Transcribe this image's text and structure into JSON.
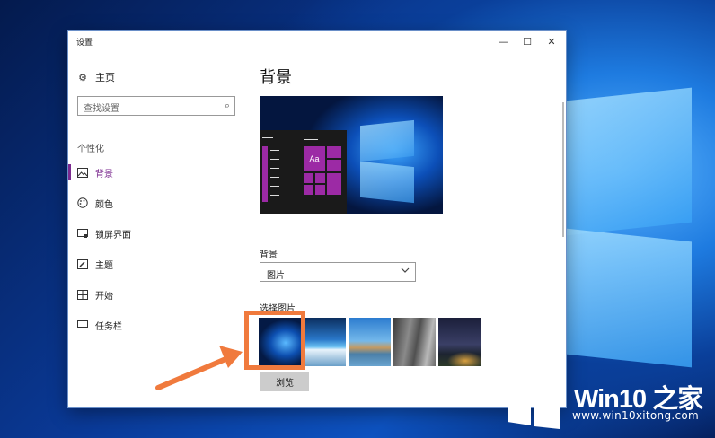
{
  "window": {
    "title": "设置",
    "controls": {
      "minimize": "—",
      "maximize": "☐",
      "close": "✕"
    }
  },
  "sidebar": {
    "home_label": "主页",
    "search_placeholder": "查找设置",
    "section_label": "个性化",
    "items": [
      {
        "label": "背景",
        "icon": "picture-icon",
        "active": true
      },
      {
        "label": "颜色",
        "icon": "palette-icon",
        "active": false
      },
      {
        "label": "锁屏界面",
        "icon": "lock-screen-icon",
        "active": false
      },
      {
        "label": "主题",
        "icon": "theme-icon",
        "active": false
      },
      {
        "label": "开始",
        "icon": "start-icon",
        "active": false
      },
      {
        "label": "任务栏",
        "icon": "taskbar-icon",
        "active": false
      }
    ]
  },
  "main": {
    "page_title": "背景",
    "preview_tile_text": "Aa",
    "background_label": "背景",
    "background_value": "图片",
    "choose_picture_label": "选择图片",
    "thumbnails": [
      "windows-10-hero",
      "beach-night",
      "rock-arch-beach",
      "cliff-rock",
      "starry-night-tent"
    ],
    "selected_thumbnail": 0,
    "browse_label": "浏览"
  },
  "watermark": {
    "brand_part1": "Win10 ",
    "brand_part2": "之家",
    "site": "www.win10xitong.com"
  },
  "colors": {
    "accent": "#7b2a8f",
    "highlight": "#f07a3d",
    "tile": "#9c2aa5"
  }
}
